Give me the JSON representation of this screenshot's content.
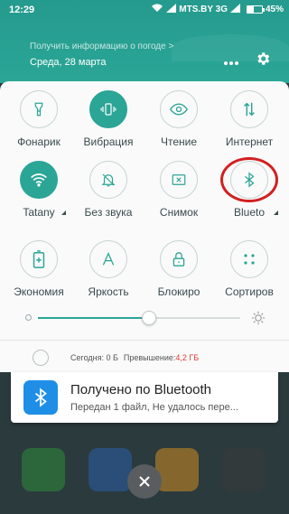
{
  "status_bar": {
    "time": "12:29",
    "carrier": "MTS.BY 3G",
    "battery_percent": "45%",
    "battery_level": 0.45
  },
  "header": {
    "weather_prompt": "Получить информацию о погоде >",
    "date": "Среда, 28 марта",
    "more_icon": "more-dots-icon",
    "settings_icon": "gear-icon"
  },
  "tiles": [
    {
      "label": "Фонарик",
      "icon": "flashlight-icon",
      "active": false
    },
    {
      "label": "Вибрация",
      "icon": "vibration-icon",
      "active": true
    },
    {
      "label": "Чтение",
      "icon": "eye-icon",
      "active": false
    },
    {
      "label": "Интернет",
      "icon": "data-arrows-icon",
      "active": false
    },
    {
      "label": "Tatany",
      "icon": "wifi-icon",
      "active": true
    },
    {
      "label": "Без звука",
      "icon": "bell-mute-icon",
      "active": false
    },
    {
      "label": "Снимок",
      "icon": "screenshot-icon",
      "active": false
    },
    {
      "label": "Blueto",
      "icon": "bluetooth-icon",
      "active": false
    },
    {
      "label": "Экономия",
      "icon": "battery-saver-icon",
      "active": false
    },
    {
      "label": "Яркость",
      "icon": "auto-brightness-icon",
      "active": false
    },
    {
      "label": "Блокиро",
      "icon": "rotation-lock-icon",
      "active": false
    },
    {
      "label": "Сортиров",
      "icon": "sort-icon",
      "active": false
    }
  ],
  "brightness": {
    "level": 0.55
  },
  "storage": {
    "today_label": "Сегодня: 0 Б",
    "exceed_label": "Превышение:",
    "exceed_value": "4,2 ГБ"
  },
  "notification": {
    "icon": "bluetooth-icon",
    "title": "Получено по Bluetooth",
    "text": "Передан 1 файл, Не удалось пере..."
  },
  "colors": {
    "accent": "#2aa596",
    "highlight": "#d22020",
    "bluetooth": "#1e8ee6"
  }
}
